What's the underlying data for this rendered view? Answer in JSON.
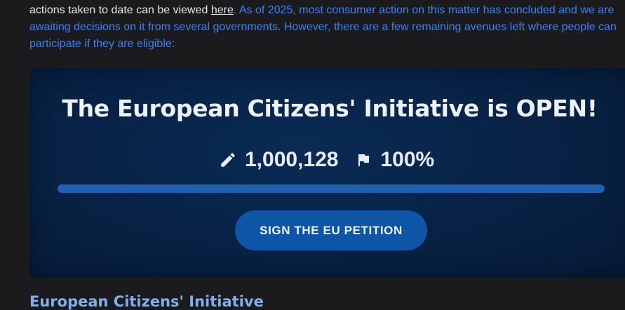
{
  "intro": {
    "line1_text": "actions taken to date can be viewed ",
    "line1_link": "here",
    "line1_after": ". As of 2025, most consumer action on this matter has concluded and we are",
    "line2": "awaiting decisions on it from several governments. However, there are a few remaining avenues left where people can",
    "line3": "participate if they are eligible:"
  },
  "banner": {
    "title": "The European Citizens' Initiative is OPEN!",
    "signatures": "1,000,128",
    "percent": "100%",
    "progress_fraction": 1.0,
    "button_label": "SIGN THE EU PETITION",
    "icons": {
      "signatures": "pencil-icon",
      "goal": "flag-icon"
    }
  },
  "section": {
    "heading": "European Citizens' Initiative"
  },
  "colors": {
    "page_bg": "#1b1b1d",
    "link_blue": "#3b82f0",
    "banner_bg": "#082347",
    "button_bg": "#0e55a7",
    "heading_blue": "#7fb0ee"
  }
}
